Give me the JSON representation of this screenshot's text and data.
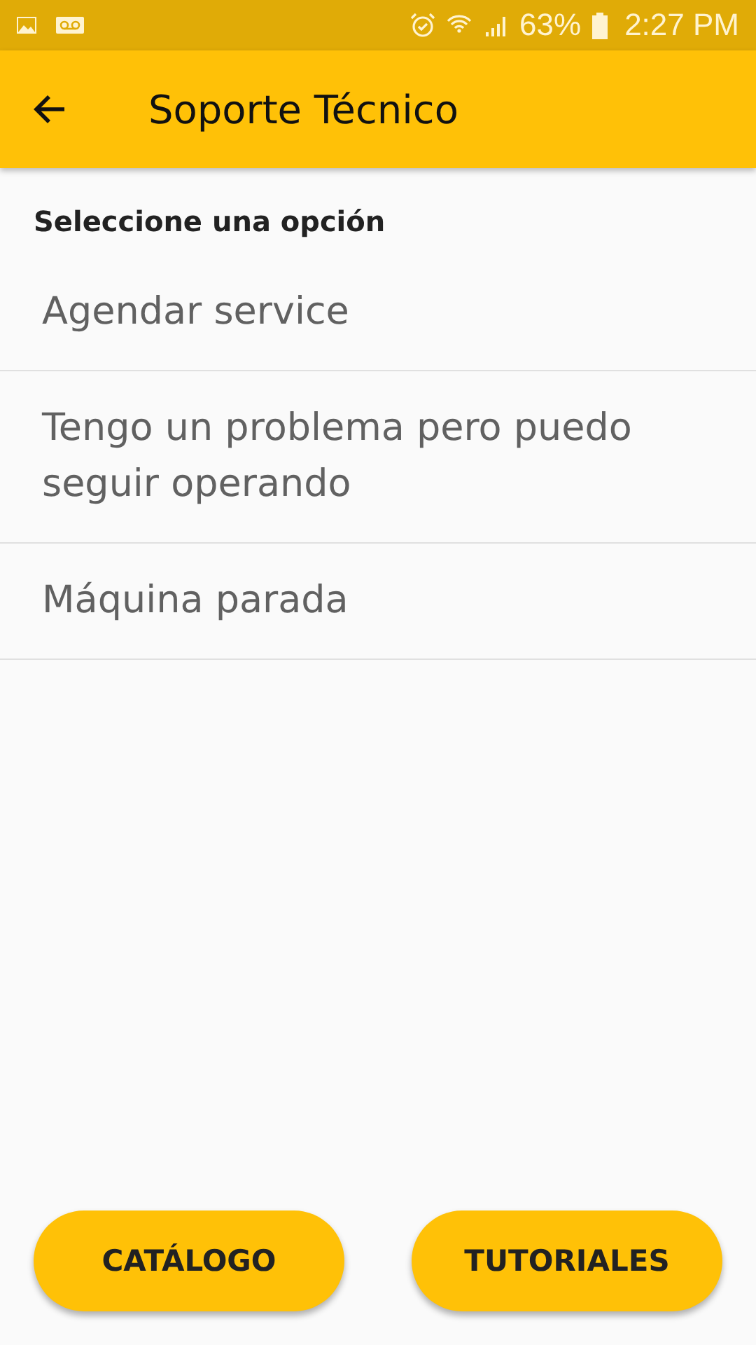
{
  "status_bar": {
    "battery": "63%",
    "time": "2:27 PM"
  },
  "app_bar": {
    "title": "Soporte Técnico"
  },
  "prompt": "Seleccione una opción",
  "options": [
    {
      "label": "Agendar service"
    },
    {
      "label": "Tengo un problema pero puedo seguir operando"
    },
    {
      "label": "Máquina parada"
    }
  ],
  "buttons": [
    {
      "label": "CATÁLOGO"
    },
    {
      "label": "TUTORIALES"
    }
  ]
}
